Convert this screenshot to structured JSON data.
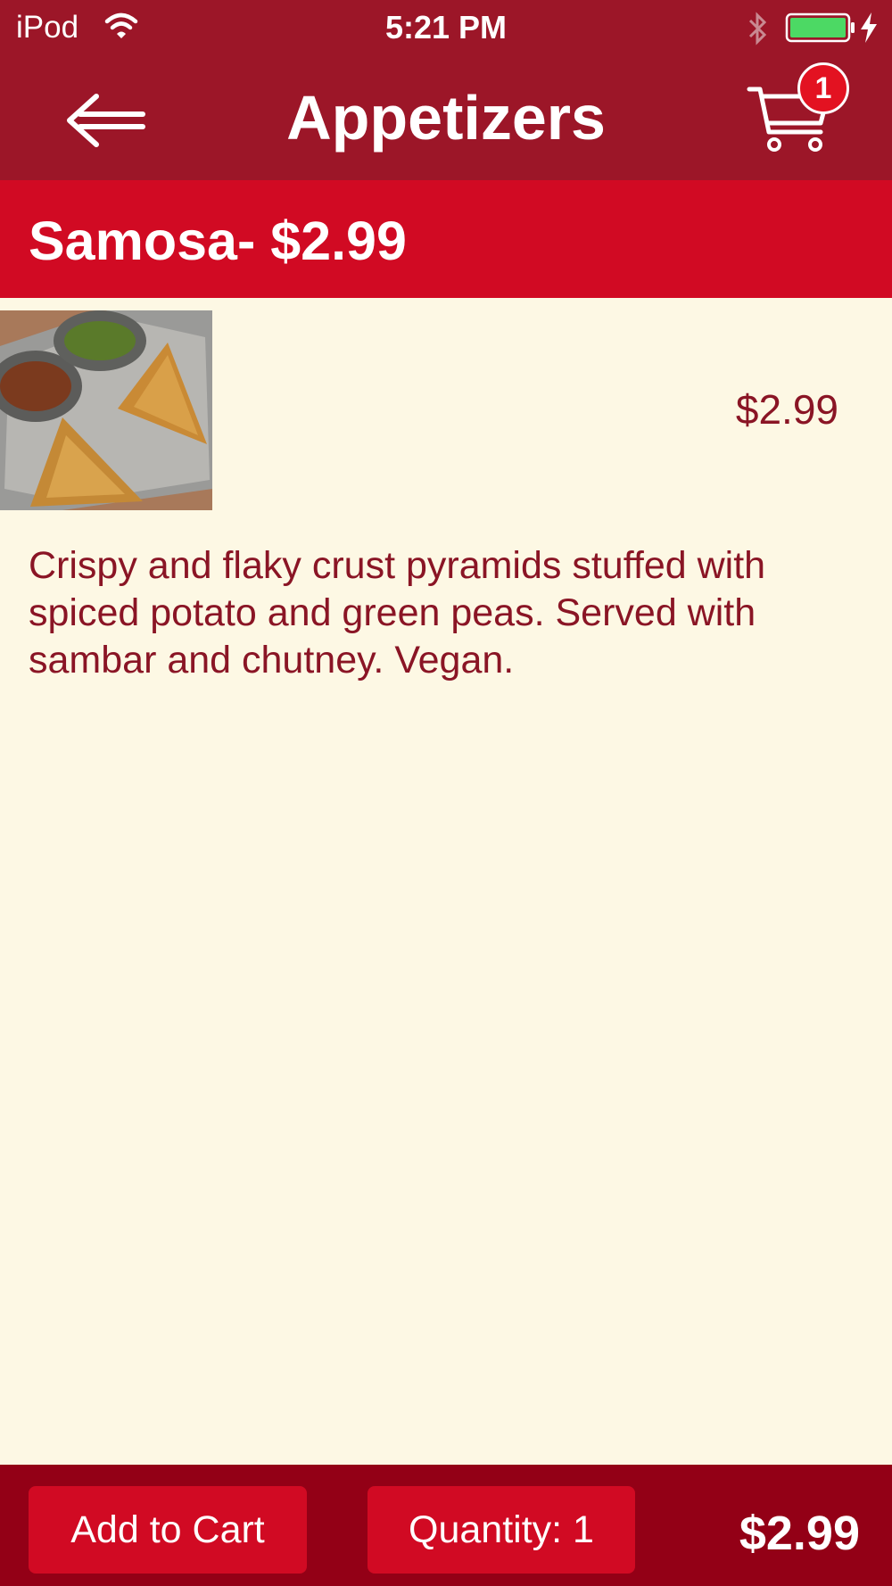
{
  "status_bar": {
    "carrier": "iPod",
    "time": "5:21 PM",
    "icons": [
      "wifi-icon",
      "bluetooth-icon",
      "battery-icon",
      "charging-icon"
    ]
  },
  "nav": {
    "title": "Appetizers",
    "back_icon": "arrow-left-icon",
    "cart_icon": "shopping-cart-icon",
    "cart_count": "1"
  },
  "item": {
    "title": "Samosa- $2.99",
    "price": "$2.99",
    "image_icon": "samosa-photo",
    "description": "Crispy and flaky crust pyramids stuffed with spiced potato and green peas. Served with sambar and chutney. Vegan."
  },
  "bottom_bar": {
    "add_to_cart_label": "Add to Cart",
    "quantity_label": "Quantity: 1",
    "total": "$2.99"
  },
  "colors": {
    "nav_background": "#9c1628",
    "item_header_background": "#d10a23",
    "page_background": "#fdf8e4",
    "text_accent": "#8a1525",
    "bottom_bar_background": "#930016",
    "battery_fill": "#4cd964"
  }
}
